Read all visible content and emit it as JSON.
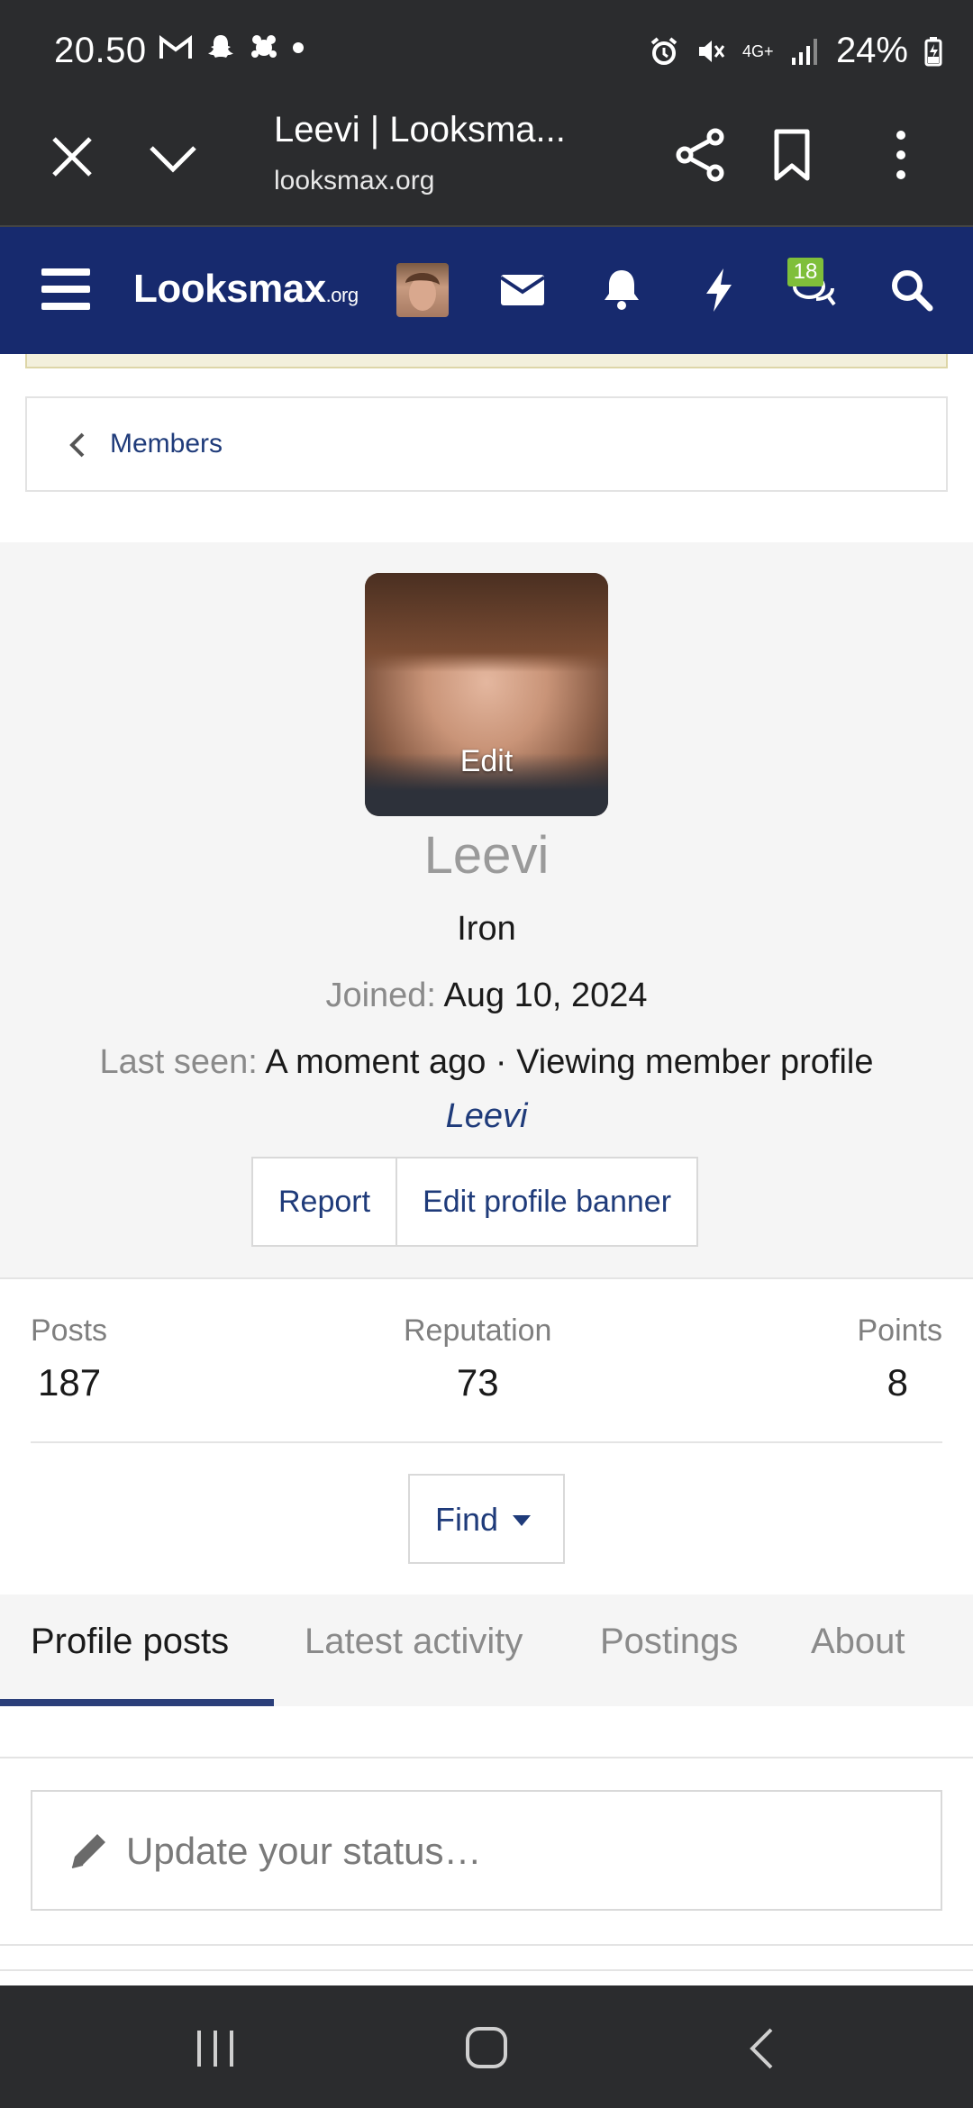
{
  "status_bar": {
    "time": "20.50",
    "battery": "24%",
    "network": "4G+"
  },
  "browser": {
    "title": "Leevi | Looksma...",
    "url": "looksmax.org"
  },
  "site_header": {
    "logo_main": "Looksmax",
    "logo_suffix": ".org",
    "conversations_badge": "18",
    "colors": {
      "header_bg": "#172a6e",
      "badge_bg": "#7fbf3a"
    }
  },
  "breadcrumb": {
    "label": "Members"
  },
  "profile": {
    "avatar_edit_label": "Edit",
    "name": "Leevi",
    "rank": "Iron",
    "joined_label": "Joined:",
    "joined_value": "Aug 10, 2024",
    "last_seen_label": "Last seen:",
    "last_seen_value": "A moment ago · Viewing member profile",
    "viewing_member_name": "Leevi",
    "actions": {
      "report": "Report",
      "edit_banner": "Edit profile banner"
    }
  },
  "stats": {
    "posts_label": "Posts",
    "posts_value": "187",
    "reputation_label": "Reputation",
    "reputation_value": "73",
    "points_label": "Points",
    "points_value": "8"
  },
  "find": {
    "label": "Find"
  },
  "tabs": [
    {
      "label": "Profile posts",
      "active": true
    },
    {
      "label": "Latest activity",
      "active": false
    },
    {
      "label": "Postings",
      "active": false
    },
    {
      "label": "About",
      "active": false
    }
  ],
  "status_update": {
    "placeholder": "Update your status…"
  }
}
